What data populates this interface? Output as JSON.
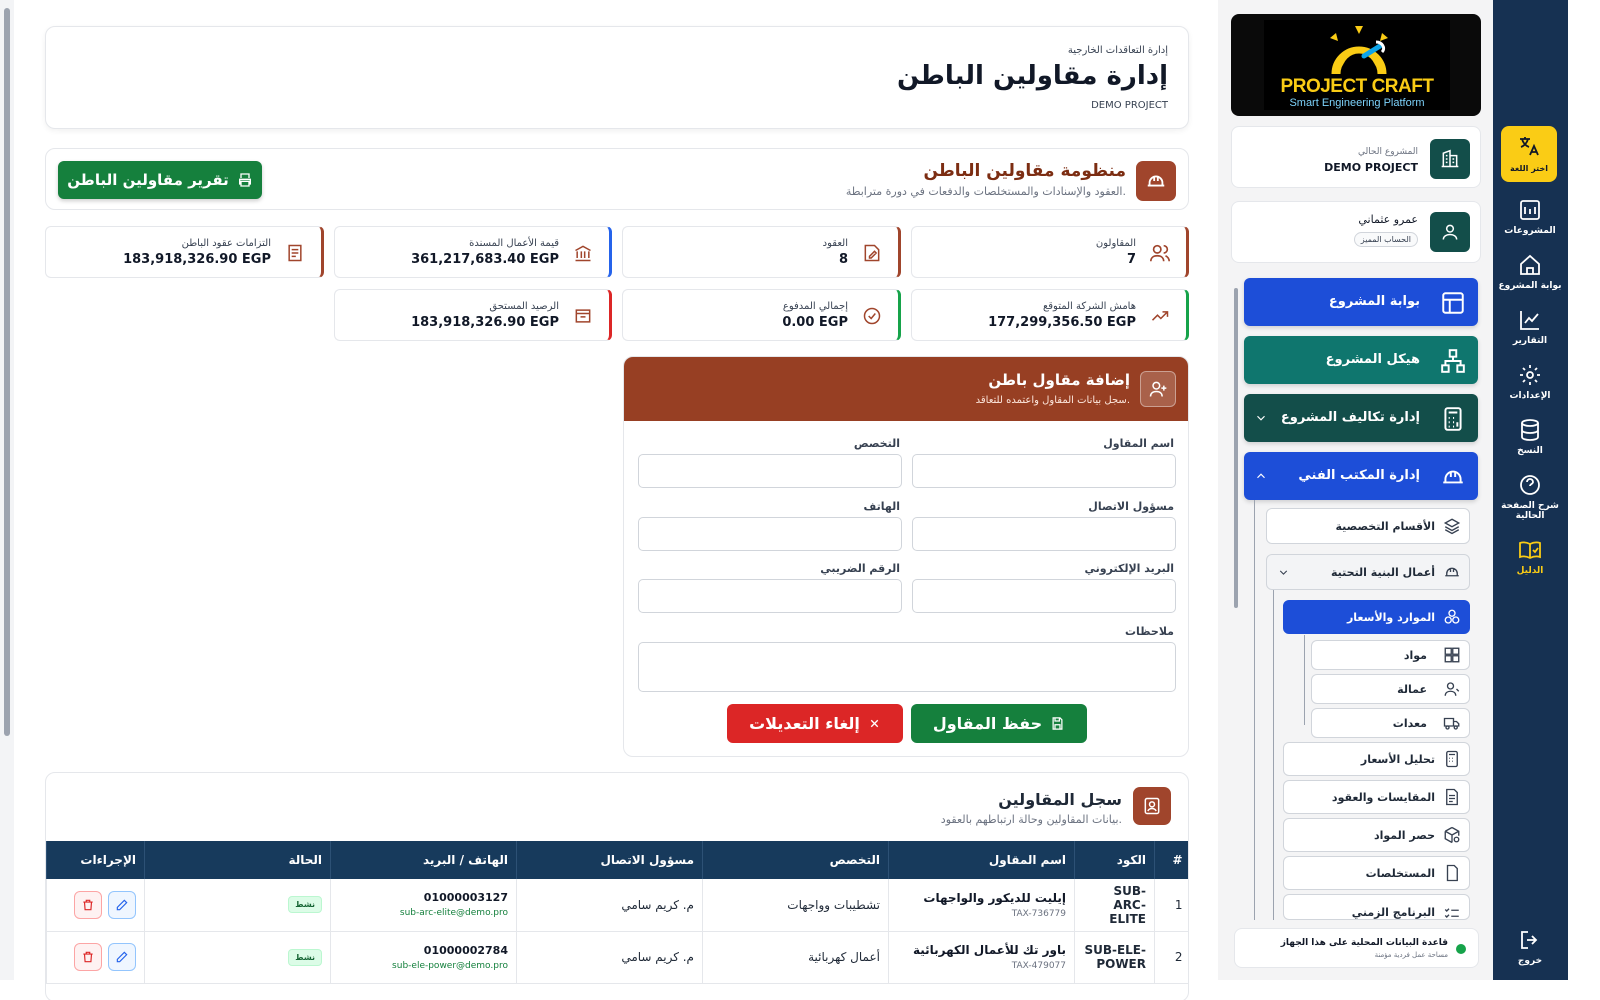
{
  "header": {
    "breadcrumb": "إدارة التعاقدات الخارجية",
    "title": "إدارة مقاولين الباطن",
    "project": "DEMO PROJECT"
  },
  "system": {
    "title": "منظومة مقاولين الباطن",
    "subtitle": "العقود والإسنادات والمستخلصات والدفعات في دورة مترابطة.",
    "print_label": "تقرير مقاولين الباطن"
  },
  "stats": {
    "contractors": {
      "label": "المقاولون",
      "value": "7"
    },
    "contracts": {
      "label": "العقود",
      "value": "8"
    },
    "assigned": {
      "label": "قيمة الأعمال المسندة",
      "value": "361,217,683.40 EGP"
    },
    "obligations": {
      "label": "التزامات عقود الباطن",
      "value": "183,918,326.90 EGP"
    },
    "margin": {
      "label": "هامش الشركة المتوقع",
      "value": "177,299,356.50 EGP"
    },
    "paid": {
      "label": "إجمالي المدفوع",
      "value": "0.00 EGP"
    },
    "balance": {
      "label": "الرصيد المستحق",
      "value": "183,918,326.90 EGP"
    }
  },
  "form": {
    "title": "إضافة مقاول باطن",
    "subtitle": "سجل بيانات المقاول واعتمده للتعاقد.",
    "name_label": "اسم المقاول",
    "specialty_label": "التخصص",
    "contact_label": "مسؤول الاتصال",
    "phone_label": "الهاتف",
    "email_label": "البريد الإلكتروني",
    "tax_label": "الرقم الضريبي",
    "notes_label": "ملاحظات",
    "save_label": "حفظ المقاول",
    "cancel_label": "إلغاء التعديلات"
  },
  "registry": {
    "title": "سجل المقاولين",
    "subtitle": "بيانات المقاولين وحالة ارتباطهم بالعقود.",
    "columns": [
      "#",
      "الكود",
      "اسم المقاول",
      "التخصص",
      "مسؤول الاتصال",
      "الهاتف / البريد",
      "الحالة",
      "الإجراءات"
    ],
    "rows": [
      {
        "num": "1",
        "code": "SUB-ARC-ELITE",
        "name": "إيليت للديكور والواجهات",
        "tax": "TAX-736779",
        "specialty": "تشطيبات وواجهات",
        "contact": "م. كريم سامي",
        "phone": "01000003127",
        "email": "sub-arc-elite@demo.pro",
        "status": "نشط"
      },
      {
        "num": "2",
        "code": "SUB-ELE-POWER",
        "name": "باور تك للأعمال الكهربائية",
        "tax": "TAX-479077",
        "specialty": "أعمال كهربائية",
        "contact": "م. كريم سامي",
        "phone": "01000002784",
        "email": "sub-ele-power@demo.pro",
        "status": "نشط"
      }
    ]
  },
  "sidebar": {
    "logo_title": "PROJECT CRAFT",
    "logo_sub": "Smart Engineering Platform",
    "current_project_label": "المشروع الحالي",
    "current_project": "DEMO PROJECT",
    "user_name": "عمرو عثماني",
    "user_badge": "الحساب المميز",
    "nav": {
      "portal": "بوابة المشروع",
      "structure": "هيكل المشروع",
      "costs": "إدارة تكاليف المشروع",
      "tech_office": "إدارة المكتب الفني"
    },
    "sub": {
      "divisions": "الأقسام التخصصية",
      "infra": "أعمال البنية التحتية",
      "resources": "الموارد والأسعار",
      "materials": "مواد",
      "labor": "عمالة",
      "equipment": "معدات",
      "price_analysis": "تحليل الأسعار",
      "measurements": "المقايسات والعقود",
      "takeoff": "حصر المواد",
      "invoices": "المستخلصات",
      "schedule": "البرنامج الزمني"
    },
    "local_db": "قاعدة البيانات المحلية على هذا الجهاز",
    "local_db_sub": "مساحة عمل فردية مؤمنة"
  },
  "rail": {
    "language": "اختر اللغة",
    "projects": "المشروعات",
    "project_portal": "بوابة المشروع",
    "reports": "التقارير",
    "settings": "الإعدادات",
    "copy": "النسخ",
    "page_help": "شرح الصفحة الحالية",
    "guide": "الدليل",
    "logout": "خروج"
  },
  "colors": {
    "accent": "#973f23",
    "navy": "#163152",
    "green": "#15803d",
    "red": "#dc2626",
    "blue": "#1d4ed8",
    "teal": "#0f766e"
  }
}
